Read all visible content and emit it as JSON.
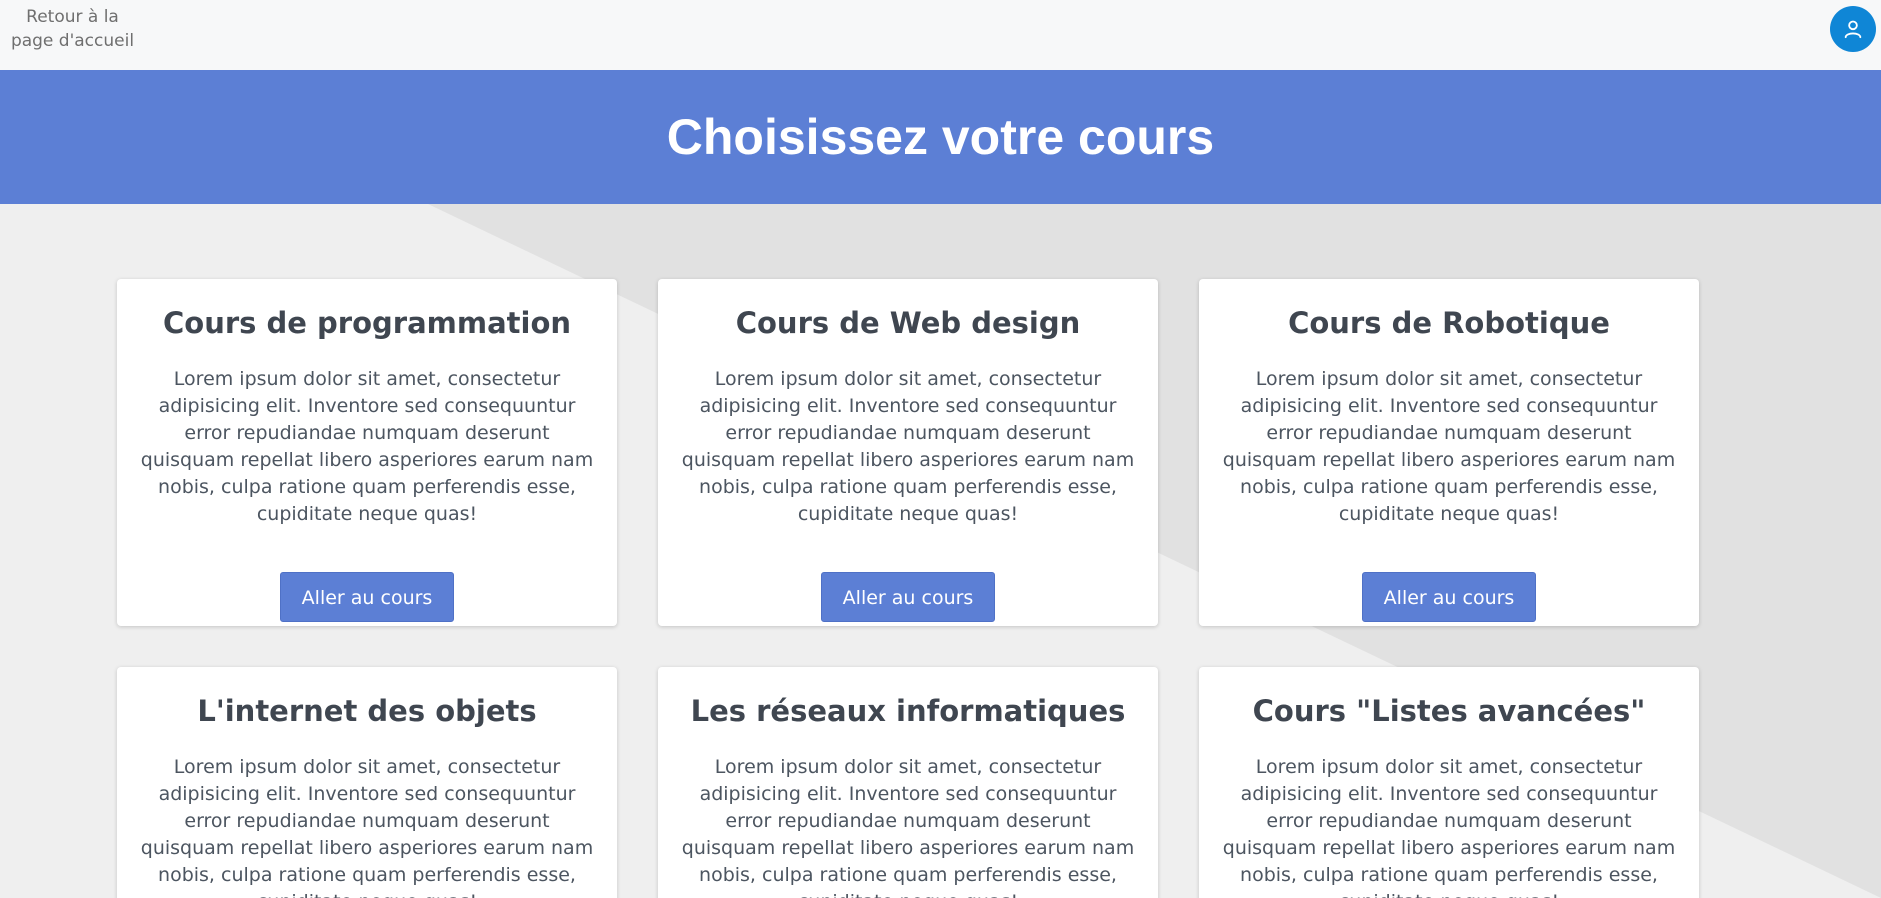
{
  "nav": {
    "back_label_line1": "Retour à la",
    "back_label_line2": "page d'accueil",
    "user_icon": "user-icon"
  },
  "hero": {
    "title": "Choisissez votre cours"
  },
  "colors": {
    "accent": "#5c7fd5",
    "user_button": "#0f86d6",
    "title_text": "#3f4650"
  },
  "courses": [
    {
      "title": "Cours de programmation",
      "description": "Lorem ipsum dolor sit amet, consectetur adipisicing elit. Inventore sed consequuntur error repudiandae numquam deserunt quisquam repellat libero asperiores earum nam nobis, culpa ratione quam perferendis esse, cupiditate neque quas!",
      "button": "Aller au cours"
    },
    {
      "title": "Cours de Web design",
      "description": "Lorem ipsum dolor sit amet, consectetur adipisicing elit. Inventore sed consequuntur error repudiandae numquam deserunt quisquam repellat libero asperiores earum nam nobis, culpa ratione quam perferendis esse, cupiditate neque quas!",
      "button": "Aller au cours"
    },
    {
      "title": "Cours de Robotique",
      "description": "Lorem ipsum dolor sit amet, consectetur adipisicing elit. Inventore sed consequuntur error repudiandae numquam deserunt quisquam repellat libero asperiores earum nam nobis, culpa ratione quam perferendis esse, cupiditate neque quas!",
      "button": "Aller au cours"
    },
    {
      "title": "L'internet des objets",
      "description": "Lorem ipsum dolor sit amet, consectetur adipisicing elit. Inventore sed consequuntur error repudiandae numquam deserunt quisquam repellat libero asperiores earum nam nobis, culpa ratione quam perferendis esse, cupiditate neque quas!",
      "button": ""
    },
    {
      "title": "Les réseaux informatiques",
      "description": "Lorem ipsum dolor sit amet, consectetur adipisicing elit. Inventore sed consequuntur error repudiandae numquam deserunt quisquam repellat libero asperiores earum nam nobis, culpa ratione quam perferendis esse, cupiditate neque quas!",
      "button": ""
    },
    {
      "title": "Cours \"Listes avancées\"",
      "description": "Lorem ipsum dolor sit amet, consectetur adipisicing elit. Inventore sed consequuntur error repudiandae numquam deserunt quisquam repellat libero asperiores earum nam nobis, culpa ratione quam perferendis esse, cupiditate neque quas!",
      "button": ""
    }
  ]
}
